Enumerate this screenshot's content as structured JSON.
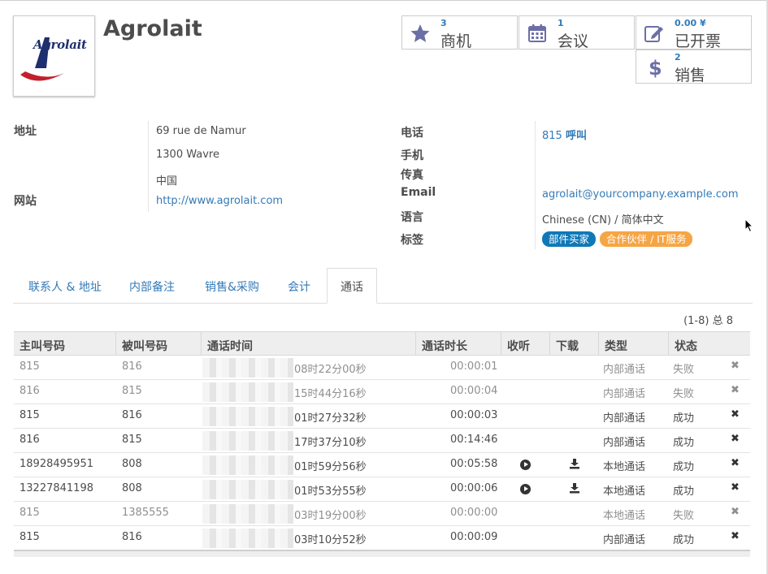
{
  "company": {
    "name": "Agrolait",
    "logo_text": "Agrolait"
  },
  "stats": [
    {
      "num": "3",
      "label": "商机",
      "icon": "star-icon"
    },
    {
      "num": "1",
      "label": "会议",
      "icon": "calendar-icon"
    },
    {
      "num": "0.00 ¥",
      "label": "已开票",
      "icon": "invoice-edit-icon"
    },
    {
      "num": "2",
      "label": "销售",
      "icon": "dollar-icon"
    }
  ],
  "fields": {
    "address_label": "地址",
    "street": "69 rue de Namur",
    "city": "1300  Wavre",
    "country": "中国",
    "website_label": "网站",
    "website": "http://www.agrolait.com",
    "phone_label": "电话",
    "phone": "815",
    "call_label": "呼叫",
    "mobile_label": "手机",
    "fax_label": "传真",
    "email_label": "Email",
    "email": "agrolait@yourcompany.example.com",
    "language_label": "语言",
    "language": "Chinese (CN) / 简体中文",
    "tags_label": "标签",
    "tags": [
      "部件买家",
      "合作伙伴 / IT服务"
    ]
  },
  "colors": {
    "tag1": "#0f79b8",
    "tag2": "#f6a545",
    "link": "#337ab7"
  },
  "tabs": [
    "联系人 & 地址",
    "内部备注",
    "销售&采购",
    "会计",
    "通话"
  ],
  "pager": "(1-8) 总 8",
  "table": {
    "headers": [
      "主叫号码",
      "被叫号码",
      "通话时间",
      "通话时长",
      "收听",
      "下载",
      "类型",
      "状态"
    ],
    "rows": [
      {
        "caller": "815",
        "callee": "816",
        "time": "08时22分00秒",
        "duration": "00:00:01",
        "listen": false,
        "download": false,
        "type": "内部通话",
        "status": "失败",
        "muted": true
      },
      {
        "caller": "816",
        "callee": "815",
        "time": "15时44分16秒",
        "duration": "00:00:04",
        "listen": false,
        "download": false,
        "type": "内部通话",
        "status": "失败",
        "muted": true
      },
      {
        "caller": "815",
        "callee": "816",
        "time": "01时27分32秒",
        "duration": "00:00:03",
        "listen": false,
        "download": false,
        "type": "内部通话",
        "status": "成功",
        "muted": false
      },
      {
        "caller": "816",
        "callee": "815",
        "time": "17时37分10秒",
        "duration": "00:14:46",
        "listen": false,
        "download": false,
        "type": "内部通话",
        "status": "成功",
        "muted": false
      },
      {
        "caller": "18928495951",
        "callee": "808",
        "time": "01时59分56秒",
        "duration": "00:05:58",
        "listen": true,
        "download": true,
        "type": "本地通话",
        "status": "成功",
        "muted": false
      },
      {
        "caller": "13227841198",
        "callee": "808",
        "time": "01时53分55秒",
        "duration": "00:00:06",
        "listen": true,
        "download": true,
        "type": "本地通话",
        "status": "成功",
        "muted": false
      },
      {
        "caller": "815",
        "callee": "1385555",
        "time": "03时19分00秒",
        "duration": "00:00:00",
        "listen": false,
        "download": false,
        "type": "本地通话",
        "status": "失败",
        "muted": true
      },
      {
        "caller": "815",
        "callee": "816",
        "time": "03时10分52秒",
        "duration": "00:00:09",
        "listen": false,
        "download": false,
        "type": "内部通话",
        "status": "成功",
        "muted": false
      }
    ],
    "delete_glyph": "✖"
  }
}
